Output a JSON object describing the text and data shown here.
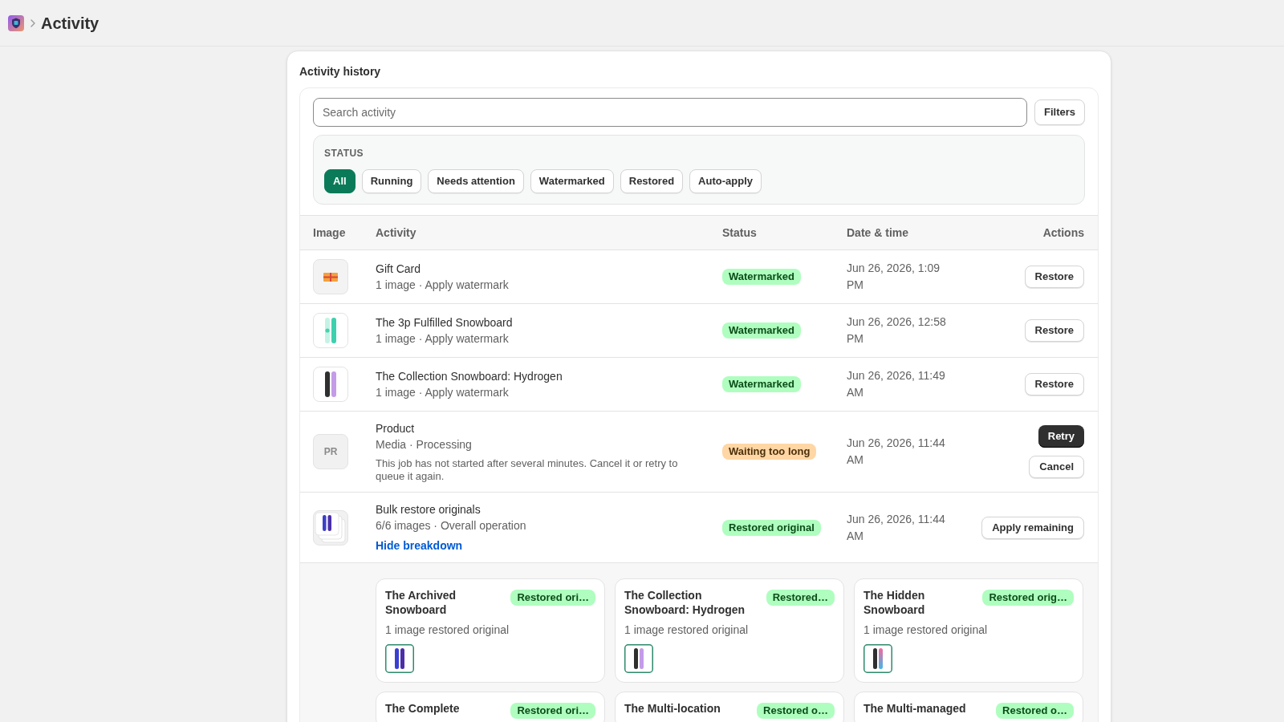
{
  "header": {
    "title": "Activity"
  },
  "activity_card": {
    "title": "Activity history"
  },
  "search": {
    "placeholder": "Search activity"
  },
  "filters_button": {
    "label": "Filters"
  },
  "status_filter": {
    "label": "STATUS",
    "chips": [
      {
        "label": "All",
        "selected": true
      },
      {
        "label": "Running",
        "selected": false
      },
      {
        "label": "Needs attention",
        "selected": false
      },
      {
        "label": "Watermarked",
        "selected": false
      },
      {
        "label": "Restored",
        "selected": false
      },
      {
        "label": "Auto-apply",
        "selected": false
      }
    ]
  },
  "table": {
    "columns": [
      "Image",
      "Activity",
      "Status",
      "Date & time",
      "Actions"
    ],
    "rows": [
      {
        "thumbnail": {
          "kind": "gift-card"
        },
        "title": "Gift Card",
        "details": "1 image · Apply watermark",
        "status": {
          "label": "Watermarked",
          "color": "#affebf"
        },
        "date": "Jun 26, 2026, 1:09 PM",
        "actions": [
          {
            "label": "Restore",
            "kind": "secondary"
          }
        ]
      },
      {
        "thumbnail": {
          "kind": "snowboards-mint"
        },
        "title": "The 3p Fulfilled Snowboard",
        "details": "1 image · Apply watermark",
        "status": {
          "label": "Watermarked",
          "color": "#affebf"
        },
        "date": "Jun 26, 2026, 12:58 PM",
        "actions": [
          {
            "label": "Restore",
            "kind": "secondary"
          }
        ]
      },
      {
        "thumbnail": {
          "kind": "snowboards-hydrogen"
        },
        "title": "The Collection Snowboard: Hydrogen",
        "details": "1 image · Apply watermark",
        "status": {
          "label": "Watermarked",
          "color": "#affebf"
        },
        "date": "Jun 26, 2026, 11:49 AM",
        "actions": [
          {
            "label": "Restore",
            "kind": "secondary"
          }
        ]
      },
      {
        "thumbnail": {
          "kind": "initials",
          "text": "PR"
        },
        "title": "Product",
        "details": "Media · Processing",
        "note": "This job has not started after several minutes. Cancel it or retry to queue it again.",
        "status": {
          "label": "Waiting too long",
          "color": "#ffd6a4"
        },
        "date": "Jun 26, 2026, 11:44 AM",
        "actions": [
          {
            "label": "Retry",
            "kind": "primary"
          },
          {
            "label": "Cancel",
            "kind": "secondary"
          }
        ]
      },
      {
        "thumbnail": {
          "kind": "image-stack"
        },
        "title": "Bulk restore originals",
        "details": "6/6 images · Overall operation",
        "status": {
          "label": "Restored original",
          "color": "#affebf"
        },
        "date": "Jun 26, 2026, 11:44 AM",
        "actions": [
          {
            "label": "Apply remaining",
            "kind": "secondary"
          }
        ],
        "breakdown": {
          "toggle_label": "Hide breakdown",
          "expanded": true,
          "items": [
            {
              "title": "The Archived Snowboard",
              "badge": {
                "label": "Restored ori…",
                "color": "#affebf"
              },
              "details": "1 image restored original",
              "thumbnail": {
                "kind": "snowboards-blue"
              }
            },
            {
              "title": "The Collection Snowboard: Hydrogen",
              "badge": {
                "label": "Restored…",
                "color": "#affebf"
              },
              "details": "1 image restored original",
              "thumbnail": {
                "kind": "snowboards-hydrogen"
              }
            },
            {
              "title": "The Hidden Snowboard",
              "badge": {
                "label": "Restored orig…",
                "color": "#affebf"
              },
              "details": "1 image restored original",
              "thumbnail": {
                "kind": "snowboards-gradient"
              }
            },
            {
              "title": "The Complete",
              "badge": {
                "label": "Restored ori…",
                "color": "#affebf"
              }
            },
            {
              "title": "The Multi-location",
              "badge": {
                "label": "Restored o…",
                "color": "#affebf"
              }
            },
            {
              "title": "The Multi-managed",
              "badge": {
                "label": "Restored o…",
                "color": "#affebf"
              }
            }
          ]
        }
      }
    ]
  }
}
